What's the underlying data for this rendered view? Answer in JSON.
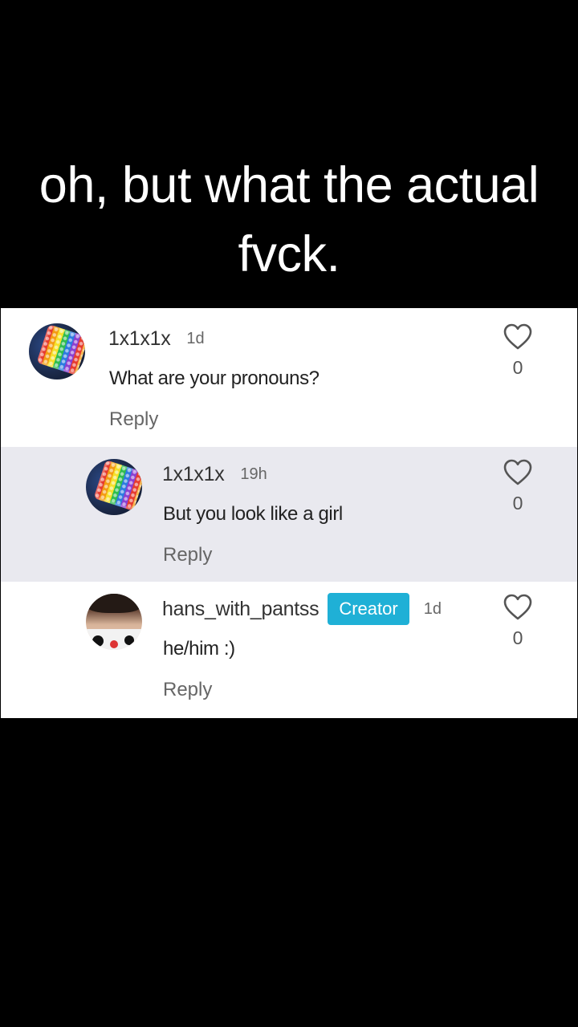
{
  "caption": {
    "line1": "oh, but what the actual",
    "line2": "fvck."
  },
  "comments": [
    {
      "username": "1x1x1x",
      "time": "1d",
      "text": "What are your pronouns?",
      "reply_label": "Reply",
      "likes": "0",
      "avatar": "rainbow-bracelets-avatar"
    },
    {
      "username": "1x1x1x",
      "time": "19h",
      "text": "But you look like a girl",
      "reply_label": "Reply",
      "likes": "0",
      "avatar": "rainbow-bracelets-avatar"
    },
    {
      "username": "hans_with_pantss",
      "badge": "Creator",
      "time": "1d",
      "text": "he/him :)",
      "reply_label": "Reply",
      "likes": "0",
      "avatar": "person-avatar"
    }
  ],
  "colors": {
    "background": "#000000",
    "caption_text": "#ffffff",
    "reply_highlight": "#e9e9ef",
    "creator_badge": "#1fb0d6"
  },
  "icons": {
    "like": "heart-outline-icon"
  }
}
